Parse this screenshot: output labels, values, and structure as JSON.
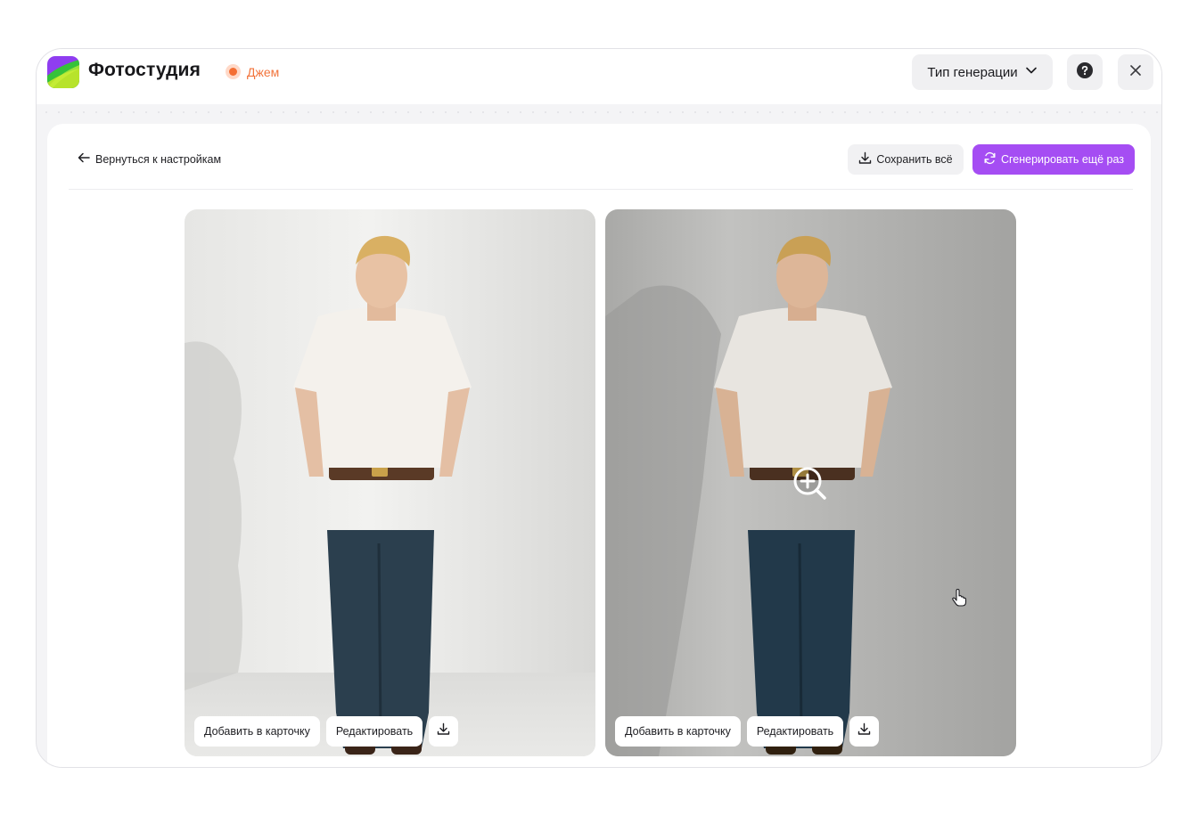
{
  "app": {
    "title": "Фотостудия",
    "project_name": "Джем",
    "project_dot_color": "#f46f34",
    "accent_color": "#a54df3"
  },
  "header": {
    "generation_type_label": "Тип генерации",
    "generation_type_icon": "chevron-down-icon",
    "help_icon": "help-icon",
    "close_icon": "close-icon"
  },
  "toolbar": {
    "back_label": "Вернуться к настройкам",
    "save_all_label": "Сохранить всё",
    "regenerate_label": "Сгенерировать ещё раз"
  },
  "results": [
    {
      "add_to_card_label": "Добавить в карточку",
      "edit_label": "Редактировать",
      "download_icon": "download-icon"
    },
    {
      "add_to_card_label": "Добавить в карточку",
      "edit_label": "Редактировать",
      "download_icon": "download-icon",
      "hover_icon": "zoom-in-icon"
    }
  ]
}
